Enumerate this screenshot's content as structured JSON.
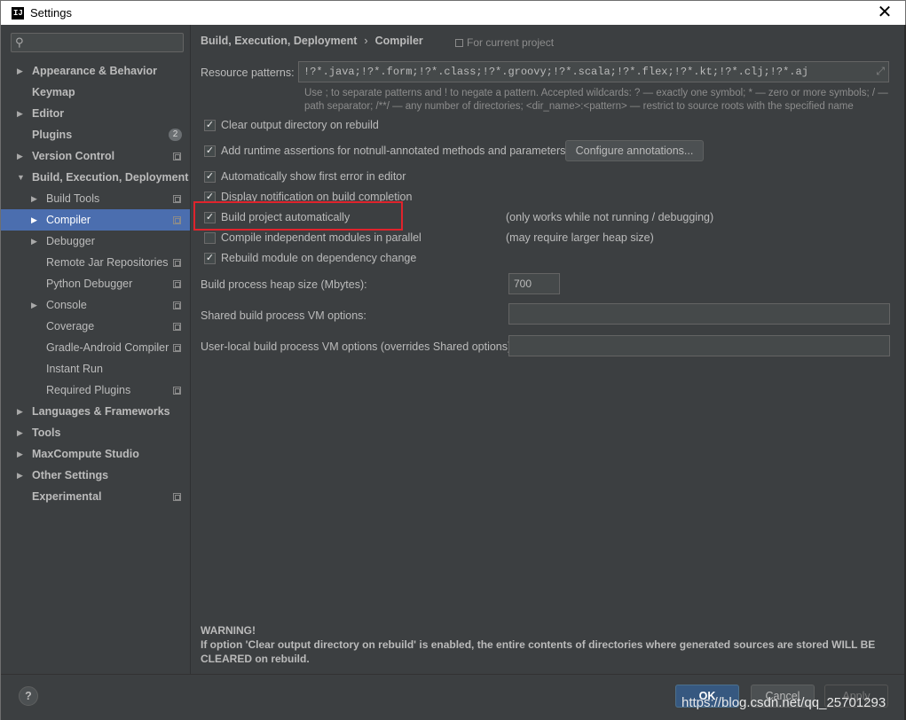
{
  "window": {
    "title": "Settings",
    "app_icon_text": "IJ"
  },
  "sidebar": {
    "search": {
      "placeholder": ""
    },
    "items": [
      {
        "label": "Appearance & Behavior",
        "bold": true,
        "arrow": "right",
        "level": 0,
        "project_icon": false
      },
      {
        "label": "Keymap",
        "bold": true,
        "arrow": "",
        "level": 0,
        "project_icon": false
      },
      {
        "label": "Editor",
        "bold": true,
        "arrow": "right",
        "level": 0,
        "project_icon": false
      },
      {
        "label": "Plugins",
        "bold": true,
        "arrow": "",
        "level": 0,
        "project_icon": false,
        "badge": "2"
      },
      {
        "label": "Version Control",
        "bold": true,
        "arrow": "right",
        "level": 0,
        "project_icon": true
      },
      {
        "label": "Build, Execution, Deployment",
        "bold": true,
        "arrow": "down",
        "level": 0,
        "project_icon": false
      },
      {
        "label": "Build Tools",
        "bold": false,
        "arrow": "right",
        "level": 1,
        "project_icon": true
      },
      {
        "label": "Compiler",
        "bold": false,
        "arrow": "right",
        "level": 1,
        "project_icon": true,
        "selected": true
      },
      {
        "label": "Debugger",
        "bold": false,
        "arrow": "right",
        "level": 1,
        "project_icon": false
      },
      {
        "label": "Remote Jar Repositories",
        "bold": false,
        "arrow": "",
        "level": 1,
        "project_icon": true
      },
      {
        "label": "Python Debugger",
        "bold": false,
        "arrow": "",
        "level": 1,
        "project_icon": true
      },
      {
        "label": "Console",
        "bold": false,
        "arrow": "right",
        "level": 1,
        "project_icon": true
      },
      {
        "label": "Coverage",
        "bold": false,
        "arrow": "",
        "level": 1,
        "project_icon": true
      },
      {
        "label": "Gradle-Android Compiler",
        "bold": false,
        "arrow": "",
        "level": 1,
        "project_icon": true
      },
      {
        "label": "Instant Run",
        "bold": false,
        "arrow": "",
        "level": 1,
        "project_icon": false
      },
      {
        "label": "Required Plugins",
        "bold": false,
        "arrow": "",
        "level": 1,
        "project_icon": true
      },
      {
        "label": "Languages & Frameworks",
        "bold": true,
        "arrow": "right",
        "level": 0,
        "project_icon": false
      },
      {
        "label": "Tools",
        "bold": true,
        "arrow": "right",
        "level": 0,
        "project_icon": false
      },
      {
        "label": "MaxCompute Studio",
        "bold": true,
        "arrow": "right",
        "level": 0,
        "project_icon": false
      },
      {
        "label": "Other Settings",
        "bold": true,
        "arrow": "right",
        "level": 0,
        "project_icon": false
      },
      {
        "label": "Experimental",
        "bold": true,
        "arrow": "",
        "level": 0,
        "project_icon": true
      }
    ]
  },
  "main": {
    "breadcrumb": {
      "parent": "Build, Execution, Deployment",
      "separator": "›",
      "current": "Compiler"
    },
    "for_current_project": "For current project",
    "resource_patterns": {
      "label": "Resource patterns:",
      "value": "!?*.java;!?*.form;!?*.class;!?*.groovy;!?*.scala;!?*.flex;!?*.kt;!?*.clj;!?*.aj"
    },
    "hint_line1": "Use ; to separate patterns and ! to negate a pattern. Accepted wildcards: ? — exactly one symbol; * — zero or more symbols; / —",
    "hint_line2": "path separator; /**/ — any number of directories; <dir_name>:<pattern> — restrict to source roots with the specified name",
    "options": [
      {
        "label": "Clear output directory on rebuild",
        "checked": true
      },
      {
        "label": "Add runtime assertions for notnull-annotated methods and parameters",
        "checked": true
      },
      {
        "label": "Automatically show first error in editor",
        "checked": true
      },
      {
        "label": "Display notification on build completion",
        "checked": true
      },
      {
        "label": "Build project automatically",
        "checked": true,
        "note": "(only works while not running / debugging)"
      },
      {
        "label": "Compile independent modules in parallel",
        "checked": false,
        "note": "(may require larger heap size)"
      },
      {
        "label": "Rebuild module on dependency change",
        "checked": true
      }
    ],
    "configure_annotations_button": "Configure annotations...",
    "heap_size": {
      "label": "Build process heap size (Mbytes):",
      "value": "700"
    },
    "shared_vm": {
      "label": "Shared build process VM options:",
      "value": ""
    },
    "user_vm": {
      "label": "User-local build process VM options (overrides Shared options):",
      "value": ""
    },
    "warning": {
      "title": "WARNING!",
      "text": "If option 'Clear output directory on rebuild' is enabled, the entire contents of directories where generated sources are stored WILL BE CLEARED on rebuild."
    }
  },
  "footer": {
    "help": "?",
    "ok": "OK",
    "cancel": "Cancel",
    "apply": "Apply",
    "watermark": "https://blog.csdn.net/qq_25701293"
  },
  "colors": {
    "selection": "#4b6eaf",
    "highlight": "#e0232c",
    "ok_button": "#365880"
  }
}
